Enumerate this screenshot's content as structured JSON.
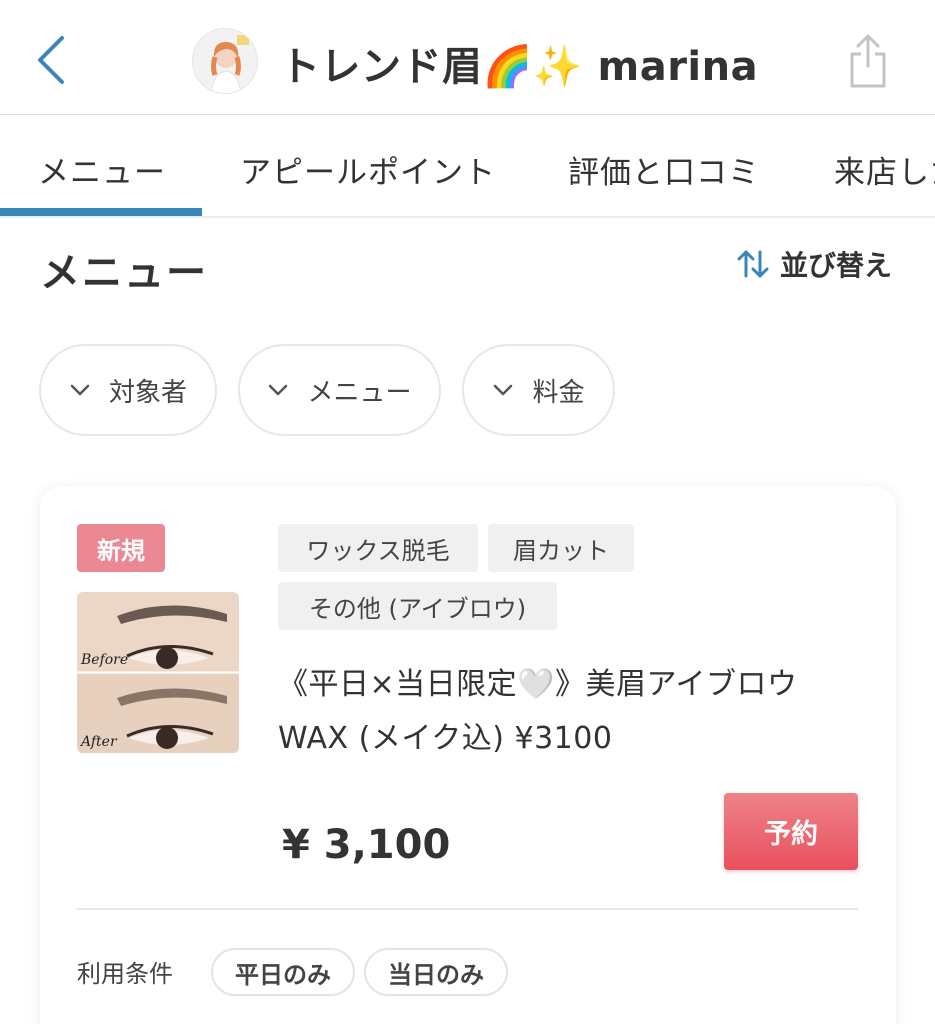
{
  "header": {
    "title": "トレンド眉🌈✨ marina",
    "back_icon": "chevron-left-icon",
    "share_icon": "share-icon",
    "accent_color": "#3a86b8"
  },
  "tabs": [
    {
      "label": "メニュー",
      "active": true
    },
    {
      "label": "アピールポイント",
      "active": false
    },
    {
      "label": "評価と口コミ",
      "active": false
    },
    {
      "label": "来店した",
      "active": false
    }
  ],
  "section": {
    "title": "メニュー",
    "sort_label": "並び替え",
    "sort_icon": "sort-arrows-icon"
  },
  "filters": [
    {
      "label": "対象者"
    },
    {
      "label": "メニュー"
    },
    {
      "label": "料金"
    }
  ],
  "menu_card": {
    "badge": "新規",
    "thumb_before": "Before",
    "thumb_after": "After",
    "tags": [
      "ワックス脱毛",
      "眉カット",
      "その他 (アイブロウ)"
    ],
    "name": "《平日×当日限定🤍》美眉アイブロウWAX (メイク込) ¥3100",
    "price": "¥ 3,100",
    "reserve_label": "予約",
    "conditions_label": "利用条件",
    "conditions": [
      "平日のみ",
      "当日のみ"
    ],
    "badge_color": "#ec8893",
    "button_color": "#e9505f"
  }
}
